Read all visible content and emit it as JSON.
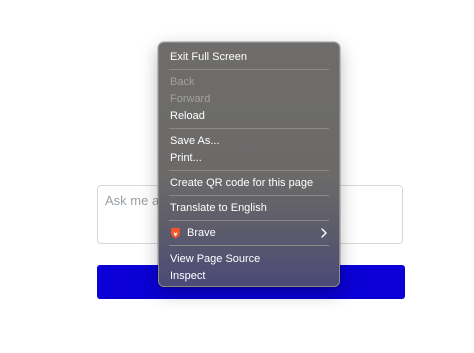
{
  "page": {
    "ask_placeholder": "Ask me a q"
  },
  "context_menu": {
    "items": [
      {
        "label": "Exit Full Screen",
        "enabled": true
      },
      {
        "label": "Back",
        "enabled": false
      },
      {
        "label": "Forward",
        "enabled": false
      },
      {
        "label": "Reload",
        "enabled": true
      },
      {
        "label": "Save As...",
        "enabled": true
      },
      {
        "label": "Print...",
        "enabled": true
      },
      {
        "label": "Create QR code for this page",
        "enabled": true
      },
      {
        "label": "Translate to English",
        "enabled": true
      },
      {
        "label": "Brave",
        "enabled": true,
        "icon": "brave-lion-icon",
        "submenu": true
      },
      {
        "label": "View Page Source",
        "enabled": true
      },
      {
        "label": "Inspect",
        "enabled": true
      }
    ]
  },
  "colors": {
    "submit_bar": "#0a00d6",
    "brave_icon": "#fb542b"
  }
}
